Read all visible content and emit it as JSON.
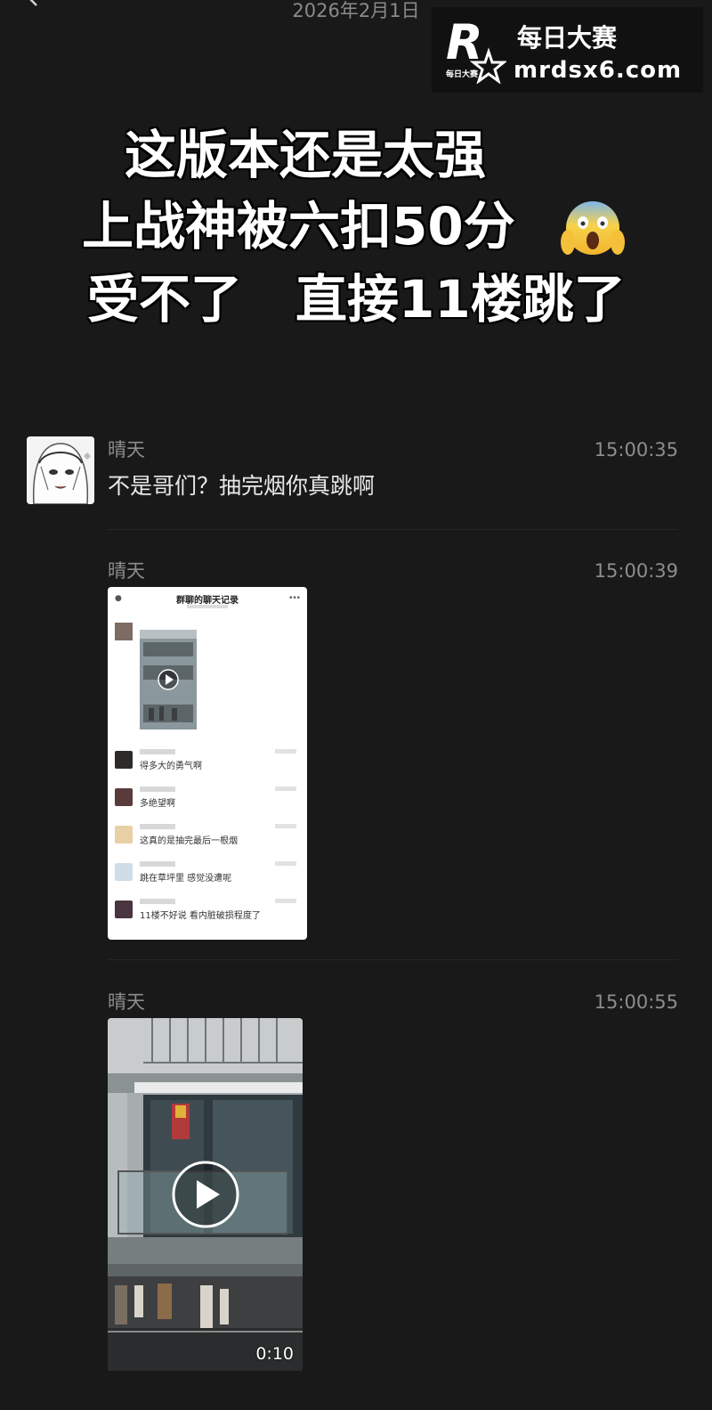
{
  "top": {
    "date": "2026年2月1日"
  },
  "watermark": {
    "brand_cn": "每日大赛",
    "site": "mrdsx6.com",
    "logo_letter": "R",
    "logo_small": "每日大赛"
  },
  "caption": {
    "line1": "这版本还是太强",
    "line2": "上战神被六扣50分",
    "line3_a": "受不了",
    "line3_b": "直接11楼跳了",
    "emoji": "face-screaming-in-fear"
  },
  "messages": [
    {
      "sender": "晴天",
      "time": "15:00:35",
      "text": "不是哥们？抽完烟你真跳啊"
    },
    {
      "sender": "晴天",
      "time": "15:00:39",
      "type": "chat-record"
    },
    {
      "sender": "晴天",
      "time": "15:00:55",
      "type": "video"
    }
  ],
  "chat_record": {
    "title": "群聊的聊天记录",
    "rows": [
      {
        "text": "得多大的勇气啊"
      },
      {
        "text": "多绝望啊"
      },
      {
        "text": "这真的是抽完最后一根烟"
      },
      {
        "text": "跳在草坪里 感觉没遭呢"
      },
      {
        "text": "11楼不好说 看内脏破损程度了"
      }
    ]
  },
  "video": {
    "duration": "0:10"
  },
  "colors": {
    "background": "#191919",
    "secondary_text": "#8d8d8d",
    "primary_text": "#e8e8e8"
  }
}
